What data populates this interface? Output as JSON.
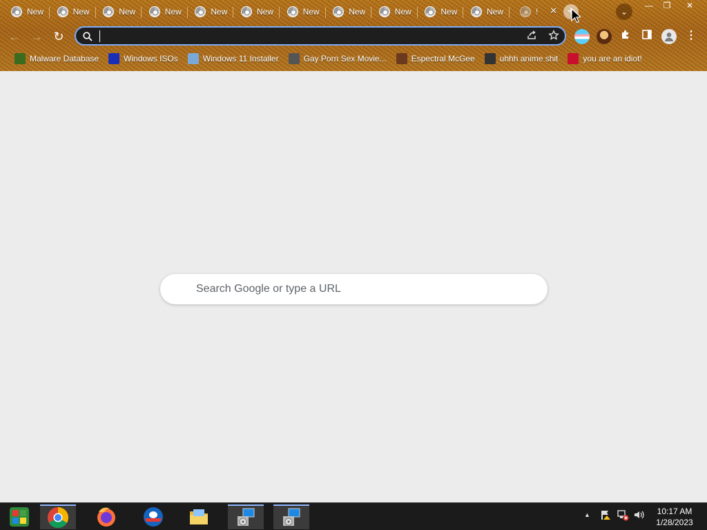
{
  "browser": {
    "tabs": [
      {
        "label": "New"
      },
      {
        "label": "New"
      },
      {
        "label": "New"
      },
      {
        "label": "New"
      },
      {
        "label": "New"
      },
      {
        "label": "New"
      },
      {
        "label": "New"
      },
      {
        "label": "New"
      },
      {
        "label": "New"
      },
      {
        "label": "New"
      },
      {
        "label": "New"
      }
    ],
    "active_tab": {
      "label": "!",
      "close": "✕"
    },
    "new_tab_symbol": "+",
    "tab_search_symbol": "⌄",
    "window_controls": {
      "minimize": "—",
      "restore": "❐",
      "close": "✕"
    },
    "nav": {
      "back": "←",
      "forward": "→",
      "reload": "↻"
    },
    "omnibox": {
      "value": "",
      "share_icon": "share-icon",
      "star_icon": "star-icon"
    },
    "accent": "#7cacf8",
    "bookmarks": [
      {
        "label": "Malware Database",
        "icon_color": "#3a6b1e"
      },
      {
        "label": "Windows ISOs",
        "icon_color": "#1a2fb5"
      },
      {
        "label": "Windows 11 Installer",
        "icon_color": "#7aa9d8"
      },
      {
        "label": "Gay Porn Sex Movie...",
        "icon_color": "#555"
      },
      {
        "label": "Espectral McGee",
        "icon_color": "#6b3a1e"
      },
      {
        "label": "uhhh anime shit",
        "icon_color": "#333"
      },
      {
        "label": "you are an idiot!",
        "icon_color": "#c8102e"
      }
    ]
  },
  "ntp": {
    "search_placeholder": "Search Google or type a URL"
  },
  "taskbar": {
    "apps": [
      {
        "name": "start"
      },
      {
        "name": "chrome"
      },
      {
        "name": "firefox"
      },
      {
        "name": "outlook"
      },
      {
        "name": "file-explorer"
      },
      {
        "name": "installer-1"
      },
      {
        "name": "installer-2"
      }
    ],
    "clock": {
      "time": "10:17 AM",
      "date": "1/28/2023"
    }
  }
}
